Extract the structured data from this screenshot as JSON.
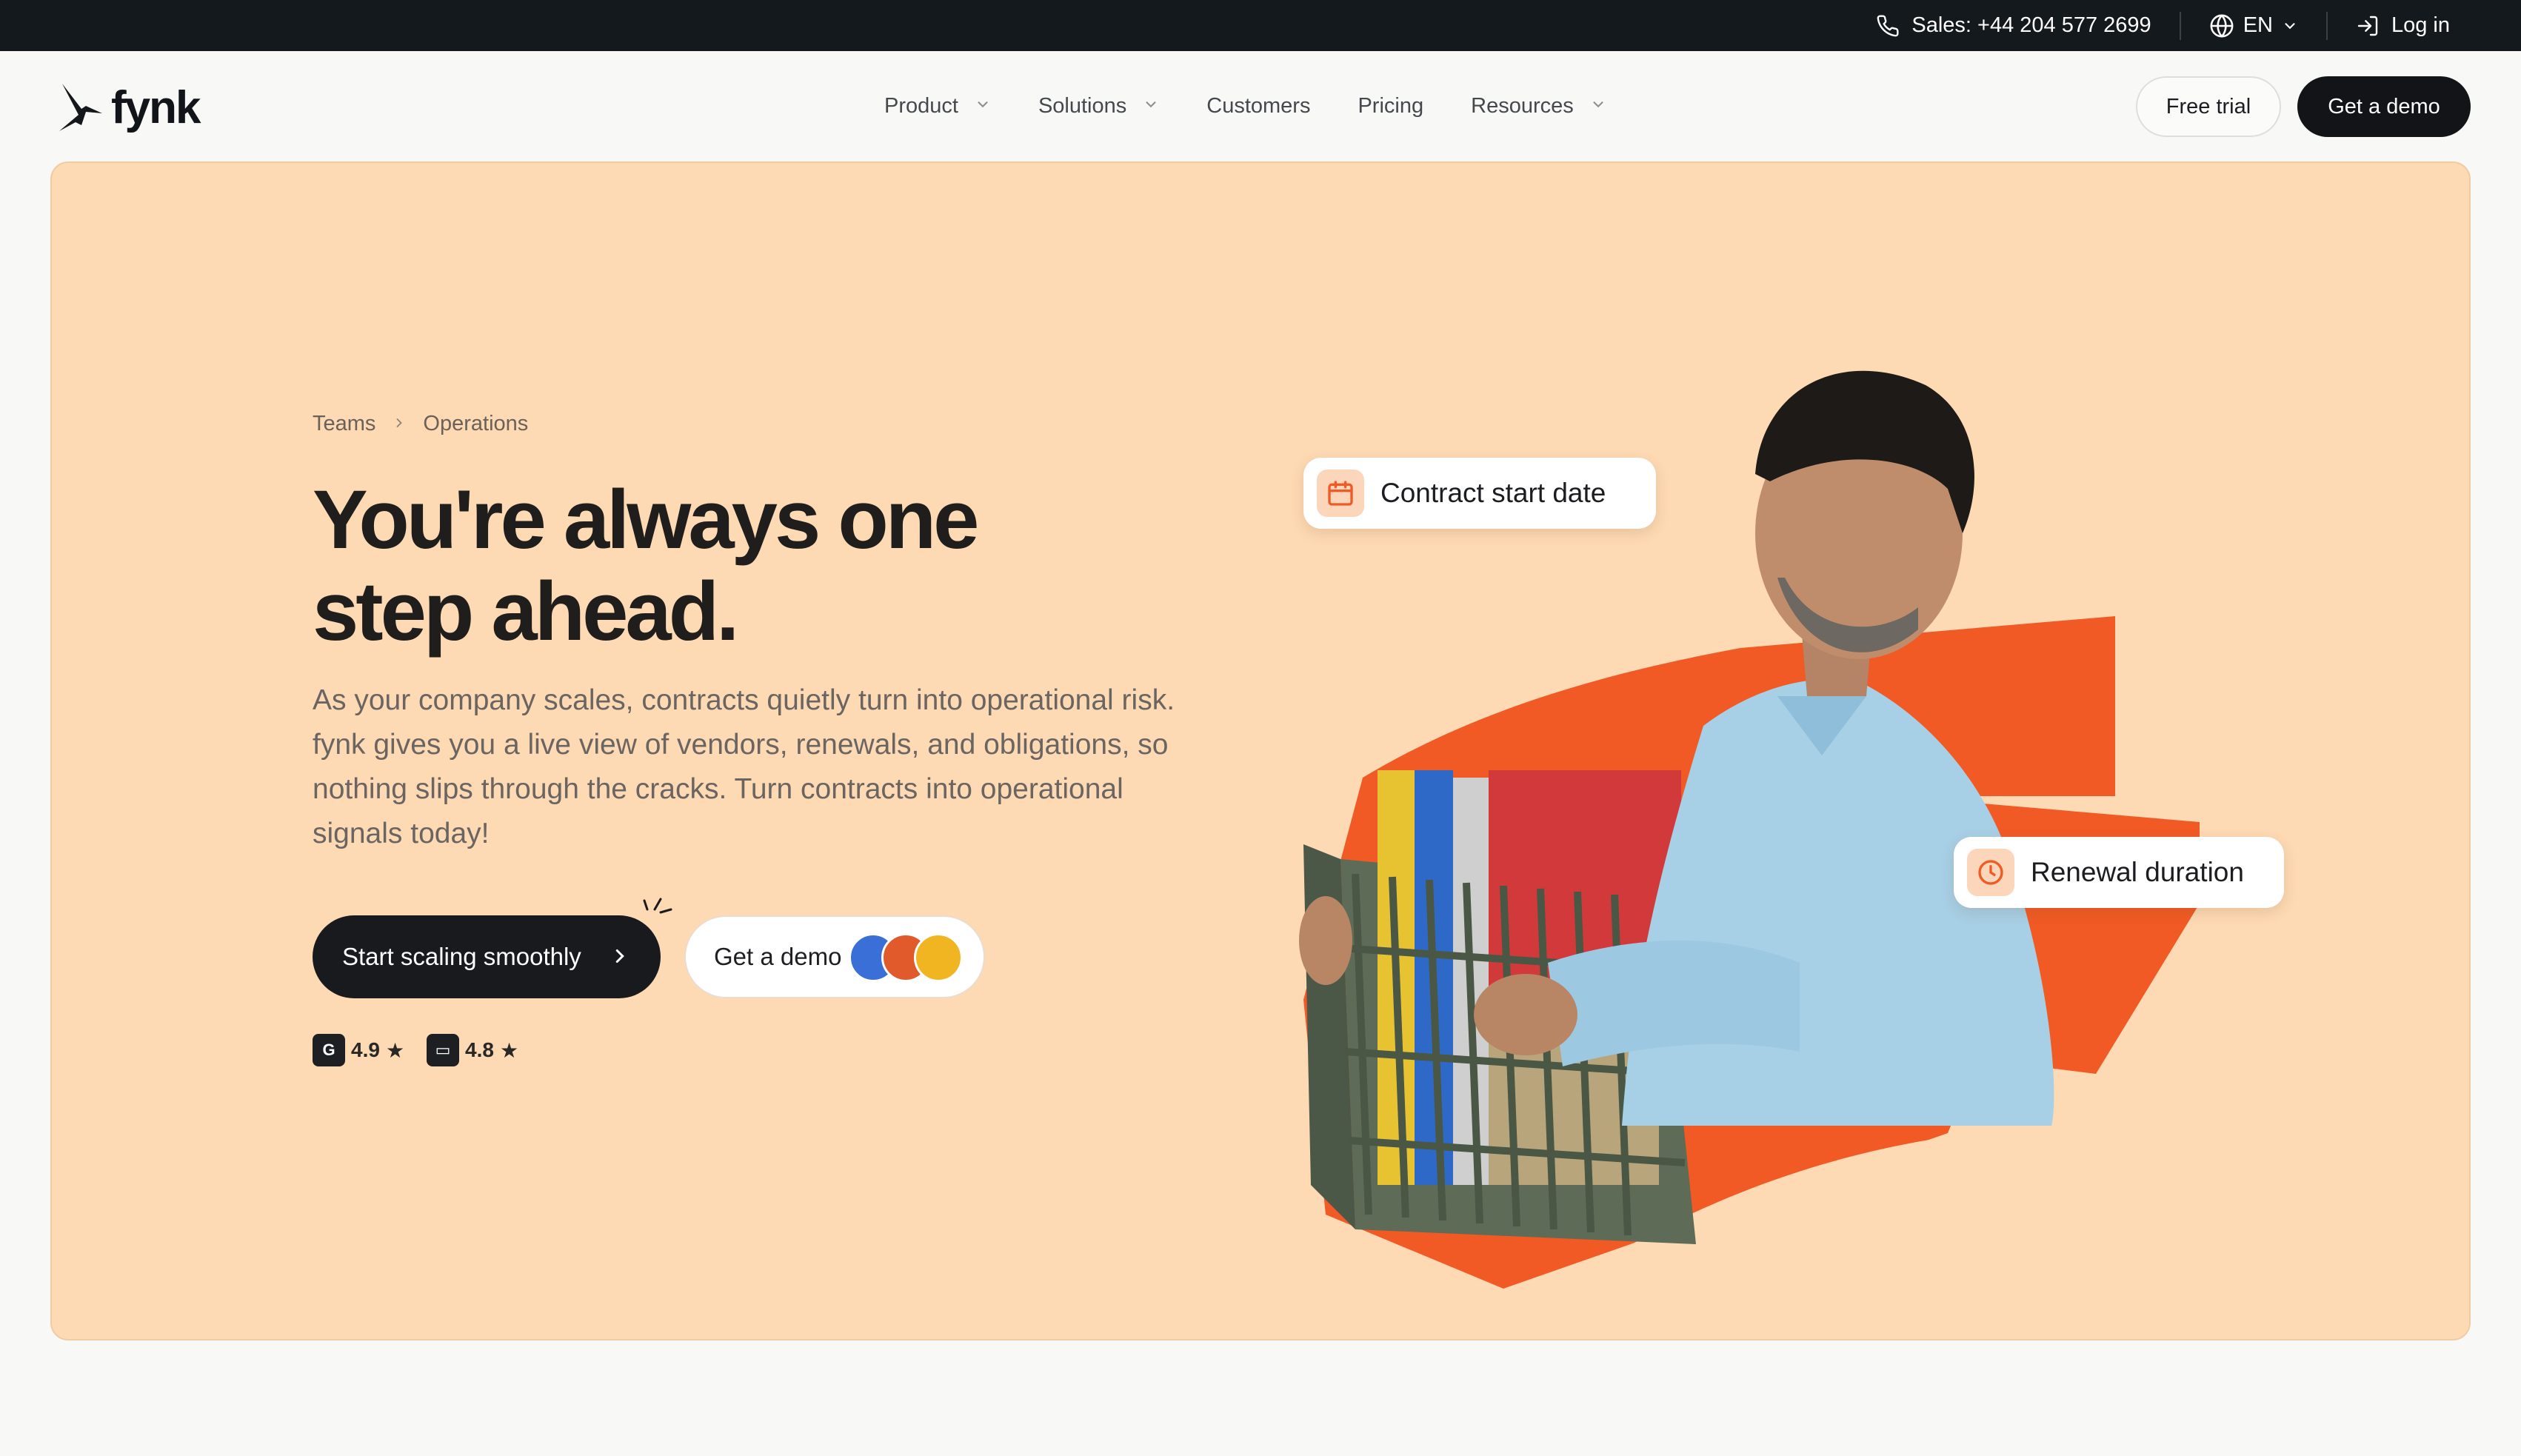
{
  "topbar": {
    "sales": "Sales: +44 204 577 2699",
    "language": "EN",
    "login": "Log in"
  },
  "nav": {
    "logo": "fynk",
    "items": [
      {
        "label": "Product",
        "dropdown": true
      },
      {
        "label": "Solutions",
        "dropdown": true
      },
      {
        "label": "Customers",
        "dropdown": false
      },
      {
        "label": "Pricing",
        "dropdown": false
      },
      {
        "label": "Resources",
        "dropdown": true
      }
    ],
    "free_trial": "Free trial",
    "get_demo": "Get a demo"
  },
  "hero": {
    "breadcrumb": [
      "Teams",
      "Operations"
    ],
    "headline_line1": "You're always one",
    "headline_line2": "step ahead.",
    "subtitle": "As your company scales, contracts quietly turn into operational risk. fynk gives you a live view of vendors, renewals, and obligations, so nothing slips through the cracks. Turn contracts into operational signals today!",
    "cta_primary": "Start scaling smoothly",
    "cta_secondary": "Get a demo",
    "ratings": [
      {
        "source_icon": "g2-icon",
        "value": "4.9"
      },
      {
        "source_icon": "capterra-icon",
        "value": "4.8"
      }
    ],
    "tag_contract": "Contract start date",
    "tag_renewal": "Renewal duration"
  },
  "colors": {
    "hero_bg": "#fdd9b4",
    "accent_orange": "#f15a24",
    "dark": "#121417"
  }
}
